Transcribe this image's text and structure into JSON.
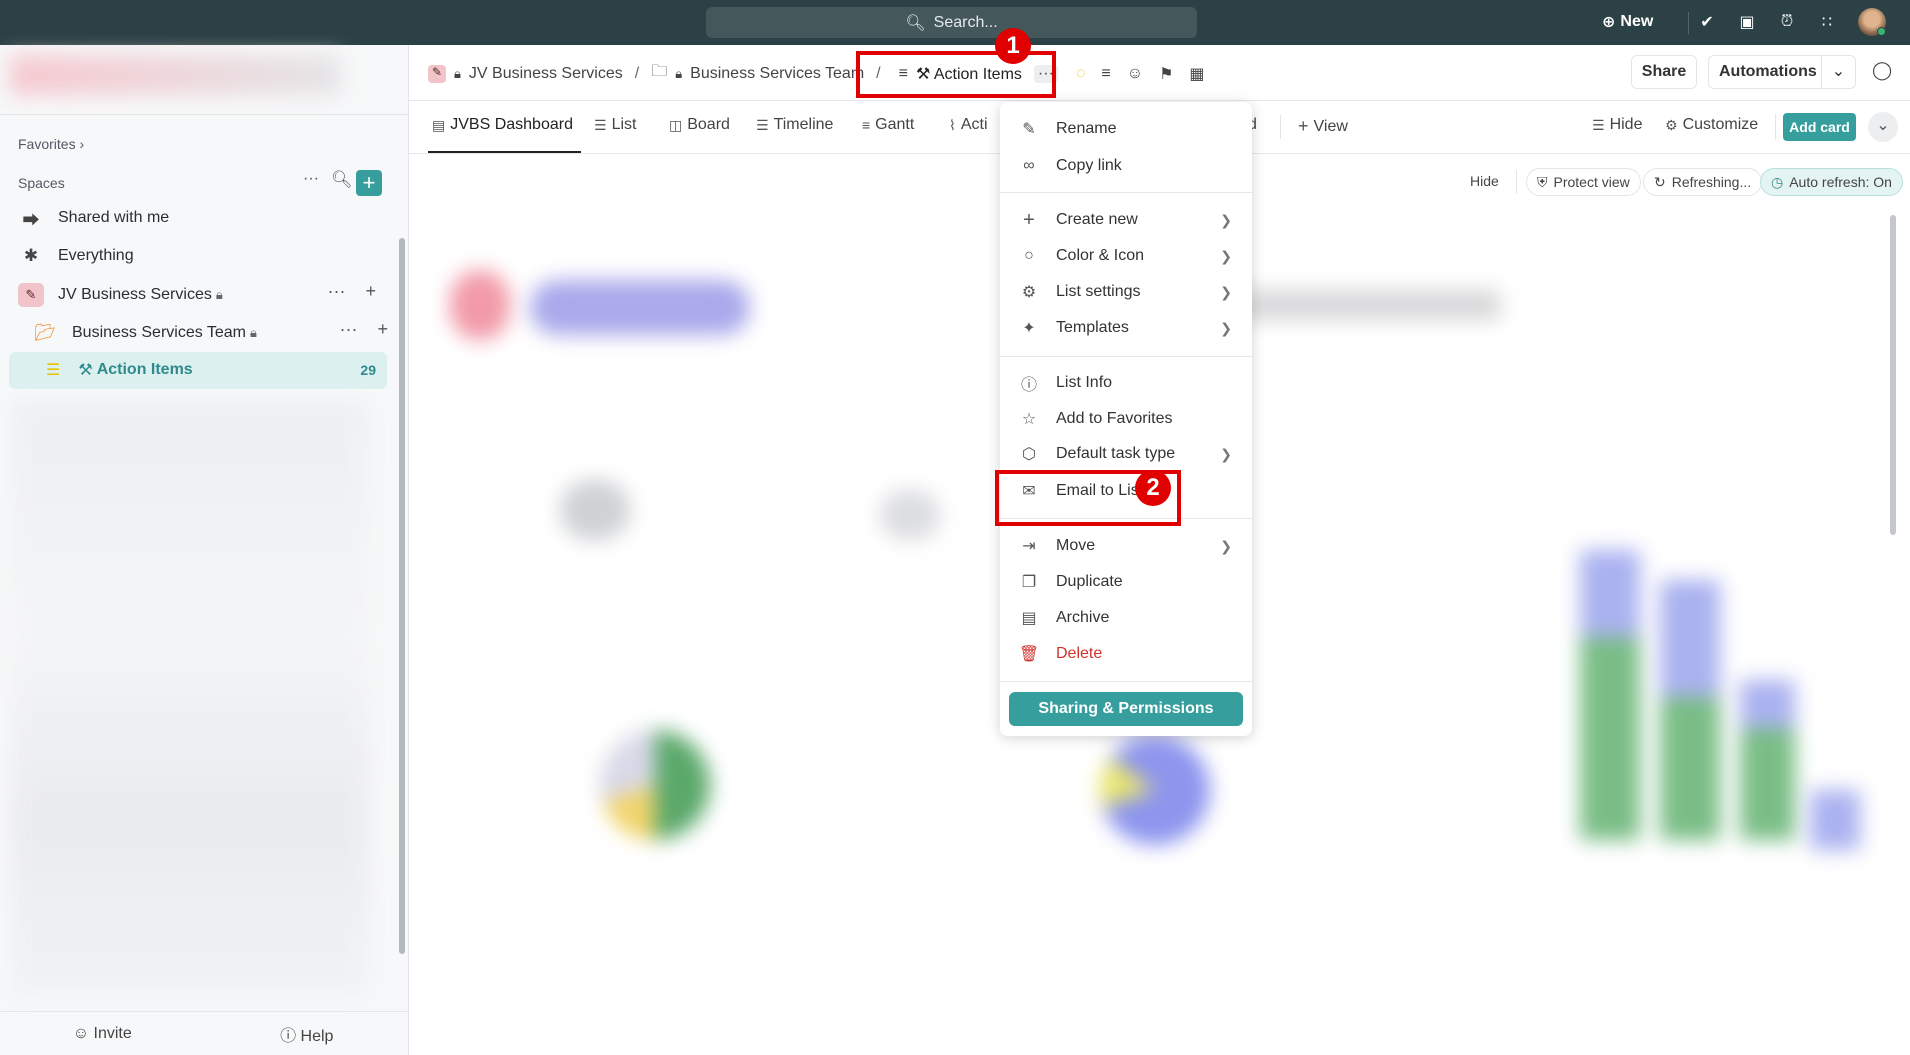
{
  "topbar": {
    "search_placeholder": "Search...",
    "new_label": "New"
  },
  "breadcrumb": {
    "space": "JV Business Services",
    "folder": "Business Services Team",
    "list": "Action Items",
    "separator": "/"
  },
  "header": {
    "share": "Share",
    "automations": "Automations"
  },
  "sidebar": {
    "favorites": "Favorites",
    "spaces": "Spaces",
    "items": [
      {
        "label": "Shared with me"
      },
      {
        "label": "Everything"
      },
      {
        "label": "JV Business Services"
      },
      {
        "label": "Business Services Team"
      },
      {
        "label": "Action Items",
        "count": "29"
      }
    ],
    "invite": "Invite",
    "help": "Help"
  },
  "tabs": [
    {
      "label": "JVBS Dashboard",
      "active": true
    },
    {
      "label": "List"
    },
    {
      "label": "Board"
    },
    {
      "label": "Timeline"
    },
    {
      "label": "Gantt"
    },
    {
      "label": "Acti"
    },
    {
      "label": "d"
    }
  ],
  "toolbar": {
    "add_view": "View",
    "hide": "Hide",
    "customize": "Customize",
    "add_card": "Add card"
  },
  "filters": {
    "hide": "Hide",
    "protect_view": "Protect view",
    "refreshing": "Refreshing...",
    "auto_refresh": "Auto refresh: On"
  },
  "menu": {
    "items": [
      {
        "label": "Rename",
        "icon": "pencil-icon"
      },
      {
        "label": "Copy link",
        "icon": "link-icon"
      },
      {
        "label": "Create new",
        "icon": "plus-icon",
        "submenu": true
      },
      {
        "label": "Color & Icon",
        "icon": "drop-icon",
        "submenu": true
      },
      {
        "label": "List settings",
        "icon": "gear-icon",
        "submenu": true
      },
      {
        "label": "Templates",
        "icon": "wand-icon",
        "submenu": true
      },
      {
        "label": "List Info",
        "icon": "info-icon"
      },
      {
        "label": "Add to Favorites",
        "icon": "star-icon"
      },
      {
        "label": "Default task type",
        "icon": "cube-icon",
        "submenu": true
      },
      {
        "label": "Email to List",
        "icon": "mail-icon"
      },
      {
        "label": "Move",
        "icon": "move-icon",
        "submenu": true
      },
      {
        "label": "Duplicate",
        "icon": "duplicate-icon"
      },
      {
        "label": "Archive",
        "icon": "archive-icon"
      },
      {
        "label": "Delete",
        "icon": "trash-icon",
        "color": "#d0342c"
      }
    ],
    "sharing": "Sharing & Permissions"
  },
  "annotations": {
    "step1": "1",
    "step2": "2"
  },
  "colors": {
    "topbar": "#2b4146",
    "accent": "#379e9e",
    "annotation": "#e00000",
    "delete": "#d0342c"
  }
}
